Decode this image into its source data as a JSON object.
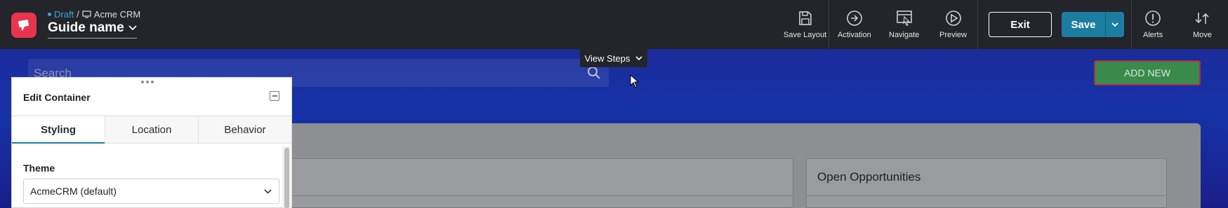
{
  "topbar": {
    "breadcrumb": {
      "status": "Draft",
      "separator": "/",
      "app": "Acme CRM"
    },
    "guide_name": "Guide name",
    "tools": {
      "save_layout": "Save Layout",
      "activation": "Activation",
      "navigate": "Navigate",
      "preview": "Preview",
      "alerts": "Alerts",
      "move": "Move"
    },
    "exit_label": "Exit",
    "save_label": "Save"
  },
  "view_steps": {
    "label": "View Steps"
  },
  "app": {
    "search_placeholder": "Search",
    "add_new_label": "ADD NEW",
    "open_opportunities_title": "Open Opportunities"
  },
  "edit_panel": {
    "title": "Edit Container",
    "tabs": [
      "Styling",
      "Location",
      "Behavior"
    ],
    "active_tab": "Styling",
    "theme_label": "Theme",
    "theme_value": "AcmeCRM (default)"
  },
  "colors": {
    "topbar_bg": "#23252b",
    "logo": "#e8344f",
    "save_button": "#1b7da0",
    "draft_status": "#3aa7d8",
    "add_new_border": "#b72b3e"
  }
}
